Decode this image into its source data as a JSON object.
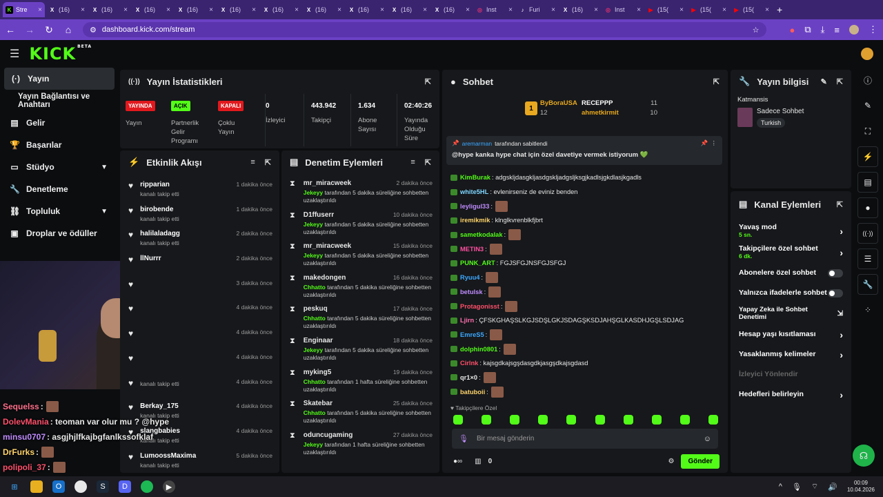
{
  "browser": {
    "tabs": [
      {
        "label": "Stre",
        "icon": "K",
        "color": "#53fc18",
        "active": true
      },
      {
        "label": "(16)",
        "icon": "X"
      },
      {
        "label": "(16)",
        "icon": "X"
      },
      {
        "label": "(16)",
        "icon": "X"
      },
      {
        "label": "(16)",
        "icon": "X"
      },
      {
        "label": "(16)",
        "icon": "X"
      },
      {
        "label": "(16)",
        "icon": "X"
      },
      {
        "label": "(16)",
        "icon": "X"
      },
      {
        "label": "(16)",
        "icon": "X"
      },
      {
        "label": "(16)",
        "icon": "X"
      },
      {
        "label": "(16)",
        "icon": "X"
      },
      {
        "label": "Inst",
        "icon": "◎",
        "color": "#e1306c"
      },
      {
        "label": "Furi",
        "icon": "♪"
      },
      {
        "label": "(16)",
        "icon": "X"
      },
      {
        "label": "Inst",
        "icon": "◎",
        "color": "#e1306c"
      },
      {
        "label": "(15(",
        "icon": "▶",
        "color": "#ff0000"
      },
      {
        "label": "(15(",
        "icon": "▶",
        "color": "#ff0000"
      },
      {
        "label": "(15(",
        "icon": "▶",
        "color": "#ff0000"
      }
    ],
    "url": "dashboard.kick.com/stream"
  },
  "brand": {
    "logo": "KICK",
    "beta": "BETA",
    "accent": "#53fc18"
  },
  "sidebar": {
    "items": [
      {
        "label": "Yayın",
        "icon": "broadcast-icon",
        "active": true
      },
      {
        "label": "Yayın Bağlantısı ve Anahtarı",
        "icon": ""
      },
      {
        "label": "Gelir",
        "icon": "revenue-icon"
      },
      {
        "label": "Başarılar",
        "icon": "trophy-icon"
      },
      {
        "label": "Stüdyo",
        "icon": "studio-icon",
        "chevron": true
      },
      {
        "label": "Denetleme",
        "icon": "wrench-icon"
      },
      {
        "label": "Topluluk",
        "icon": "community-icon",
        "chevron": true
      },
      {
        "label": "Droplar ve ödüller",
        "icon": "drops-icon"
      }
    ]
  },
  "stats": {
    "title": "Yayın İstatistikleri",
    "live_badge": "YAYINDA",
    "live_label": "Yayın",
    "partner_badge": "AÇIK",
    "partner_label": "Partnerlik Gelir Programı",
    "multi_badge": "KAPALI",
    "multi_label": "Çoklu Yayın",
    "viewers": "0",
    "viewers_label": "İzleyici",
    "followers": "443.942",
    "followers_label": "Takipçi",
    "subs": "1.634",
    "subs_label": "Abone Sayısı",
    "uptime": "02:40:26",
    "uptime_label": "Yayında Olduğu Süre"
  },
  "activity": {
    "title": "Etkinlik Akışı",
    "rows": [
      {
        "name": "ripparian",
        "sub": "kanalı takip etti",
        "time": "1 dakika önce"
      },
      {
        "name": "birobende",
        "sub": "kanalı takip etti",
        "time": "1 dakika önce"
      },
      {
        "name": "halilaladagg",
        "sub": "kanalı takip etti",
        "time": "2 dakika önce"
      },
      {
        "name": "llNurrr",
        "sub": "",
        "time": "2 dakika önce"
      },
      {
        "name": "",
        "sub": "",
        "time": "3 dakika önce"
      },
      {
        "name": "",
        "sub": "",
        "time": "4 dakika önce"
      },
      {
        "name": "",
        "sub": "",
        "time": "4 dakika önce"
      },
      {
        "name": "",
        "sub": "",
        "time": "4 dakika önce"
      },
      {
        "name": "",
        "sub": "kanalı takip etti",
        "time": "4 dakika önce"
      },
      {
        "name": "Berkay_175",
        "sub": "kanalı takip etti",
        "time": "4 dakika önce"
      },
      {
        "name": "slangbabies",
        "sub": "kanalı takip etti",
        "time": "4 dakika önce"
      },
      {
        "name": "LumoossMaxima",
        "sub": "kanalı takip etti",
        "time": "5 dakika önce"
      }
    ]
  },
  "moderation": {
    "title": "Denetim Eylemleri",
    "rows": [
      {
        "name": "mr_miracweek",
        "mod": "Jekeyy",
        "text": "tarafından 5 dakika süreliğine sohbetten uzaklaştırıldı",
        "time": "2 dakika önce"
      },
      {
        "name": "D1ffuserr",
        "mod": "Jekeyy",
        "text": "tarafından 5 dakika süreliğine sohbetten uzaklaştırıldı",
        "time": "10 dakika önce"
      },
      {
        "name": "mr_miracweek",
        "mod": "Jekeyy",
        "text": "tarafından 5 dakika süreliğine sohbetten uzaklaştırıldı",
        "time": "15 dakika önce"
      },
      {
        "name": "makedongen",
        "mod": "Chhatto",
        "text": "tarafından 5 dakika süreliğine sohbetten uzaklaştırıldı",
        "time": "16 dakika önce"
      },
      {
        "name": "peskuq",
        "mod": "Chhatto",
        "text": "tarafından 5 dakika süreliğine sohbetten uzaklaştırıldı",
        "time": "17 dakika önce"
      },
      {
        "name": "Enginaar",
        "mod": "Jekeyy",
        "text": "tarafından 5 dakika süreliğine sohbetten uzaklaştırıldı",
        "time": "18 dakika önce"
      },
      {
        "name": "myking5",
        "mod": "Chhatto",
        "text": "tarafından 1 hafta süreliğine sohbetten uzaklaştırıldı",
        "time": "19 dakika önce"
      },
      {
        "name": "Skatebar",
        "mod": "Chhatto",
        "text": "tarafından 5 dakika süreliğine sohbetten uzaklaştırıldı",
        "time": "25 dakika önce"
      },
      {
        "name": "oduncugaming",
        "mod": "Jekeyy",
        "text": "tarafından 1 hafta süreliğine sohbetten uzaklaştırıldı",
        "time": "27 dakika önce"
      }
    ]
  },
  "chat": {
    "title": "Sohbet",
    "top_gifter": {
      "name": "ByBoraUSA",
      "count": "12",
      "rank": "1"
    },
    "gifters": [
      {
        "name": "RECEPPP",
        "count": "11"
      },
      {
        "name": "ahmetkirmit",
        "count": "10"
      }
    ],
    "pinned": {
      "user": "aremarman",
      "by": "tarafından sabitlendi",
      "message": "@hype kanka hype chat için özel davetiye vermek istiyorum 💚"
    },
    "messages": [
      {
        "user": "KimBurak",
        "color": "#53fc18",
        "text": ": adgskljdasgkljasdgskljadgsljksgjkadlsjgkdlasjkgadls"
      },
      {
        "user": "white5HL",
        "color": "#7fd6ff",
        "text": ": evlenirseniz de eviniz benden"
      },
      {
        "user": "leyligul33",
        "color": "#c08cff",
        "text": ":",
        "emote": true
      },
      {
        "user": "iremikmik",
        "color": "#ffd36b",
        "text": ": klnglkvrenblkfjbrt"
      },
      {
        "user": "sametkodalak",
        "color": "#53fc18",
        "text": ":",
        "emote": true
      },
      {
        "user": "METIN3",
        "color": "#ff4fa0",
        "text": ":",
        "emote": true
      },
      {
        "user": "PUNK_ART",
        "color": "#53fc18",
        "text": ": FGJSFGJNSFGJSFGJ"
      },
      {
        "user": "Ryuu4",
        "color": "#3da8ff",
        "text": ":",
        "emote": true
      },
      {
        "user": "betulsk",
        "color": "#c08cff",
        "text": ":",
        "emote": true
      },
      {
        "user": "Protagonisst",
        "color": "#ff4f6a",
        "text": ":",
        "emote": true
      },
      {
        "user": "Ljirn",
        "color": "#ff6fb0",
        "text": ": ÇFSKGHAŞSLKGJSDŞLGKJSDAGŞKSDJAHŞGLKASDHJGŞLSDJAG"
      },
      {
        "user": "EmreS5",
        "color": "#3da8ff",
        "text": ":",
        "emote": true
      },
      {
        "user": "dolphin0801",
        "color": "#53fc18",
        "text": ":",
        "emote": true
      },
      {
        "user": "Cirlnk",
        "color": "#ff4f6a",
        "text": ": kajsgdkajsgşdasgdkjasgşdkajsgdasd"
      },
      {
        "user": "qr1×0",
        "color": "#e8e8e8",
        "text": ":",
        "emote": true
      },
      {
        "user": "batuboii",
        "color": "#ffd36b",
        "text": ":",
        "emote": true
      }
    ],
    "follower_only": "Takipçilere Özel",
    "input_placeholder": "Bir mesaj gönderin",
    "count": "0",
    "send": "Gönder"
  },
  "stream_info": {
    "title": "Yayın bilgisi",
    "category": "Katmansis",
    "subcategory": "Sadece Sohbet",
    "tag": "Turkish"
  },
  "channel_actions": {
    "title": "Kanal Eylemleri",
    "items": [
      {
        "label": "Yavaş mod",
        "sub": "5 sn.",
        "type": "chevron"
      },
      {
        "label": "Takipçilere özel sohbet",
        "sub": "6 dk.",
        "type": "chevron"
      },
      {
        "label": "Abonelere özel sohbet",
        "type": "toggle"
      },
      {
        "label": "Yalnızca ifadelerle sohbet",
        "type": "toggle"
      },
      {
        "label": "Yapay Zeka ile Sohbet Denetimi",
        "type": "ext"
      },
      {
        "label": "Hesap yaşı kısıtlaması",
        "type": "chevron"
      },
      {
        "label": "Yasaklanmış kelimeler",
        "type": "chevron"
      },
      {
        "label": "İzleyici Yönlendir",
        "type": "disabled"
      },
      {
        "label": "Hedefleri belirleyin",
        "type": "chevron"
      }
    ]
  },
  "overlay_chat": [
    {
      "user": "Sequelss",
      "color": "#ff6f8a",
      "text": " :",
      "emote": true
    },
    {
      "user": "DolevMania",
      "color": "#ff4f6a",
      "text": ": teoman var olur mu ? @hype"
    },
    {
      "user": "minsu0707",
      "color": "#c08cff",
      "text": ": asgjhjlfkajbgfanlkssofklaf"
    },
    {
      "user": "DrFurks",
      "color": "#ffd36b",
      "text": " :",
      "emote": true
    },
    {
      "user": "polipoli_37",
      "color": "#ff4f6a",
      "text": " :",
      "emote": true
    }
  ],
  "clock": {
    "time": "00:09",
    "date": "10.04.2026"
  }
}
